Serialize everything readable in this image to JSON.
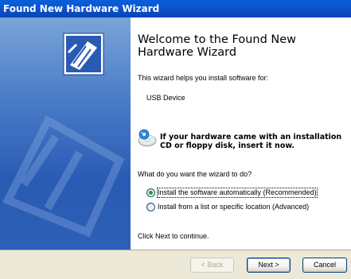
{
  "window": {
    "title": "Found New Hardware Wizard"
  },
  "content": {
    "heading": "Welcome to the Found New Hardware Wizard",
    "intro": "This wizard helps you install software for:",
    "device": "USB Device",
    "cd_notice": "If your hardware came with an installation CD or floppy disk, insert it now.",
    "question": "What do you want the wizard to do?",
    "options": [
      {
        "label": "Install the software automatically (Recommended)",
        "selected": true
      },
      {
        "label": "Install from a list or specific location (Advanced)",
        "selected": false
      }
    ],
    "continue_hint": "Click Next to continue."
  },
  "buttons": {
    "back": "< Back",
    "next": "Next >",
    "cancel": "Cancel"
  },
  "icons": {
    "sidebar": "hardware-wizard-icon",
    "cd": "cd-icon"
  },
  "colors": {
    "titlebar": "#0b56d2",
    "sidebar": "#4a7cc8",
    "radio_dot": "#21a121",
    "footer": "#ece9d8"
  }
}
